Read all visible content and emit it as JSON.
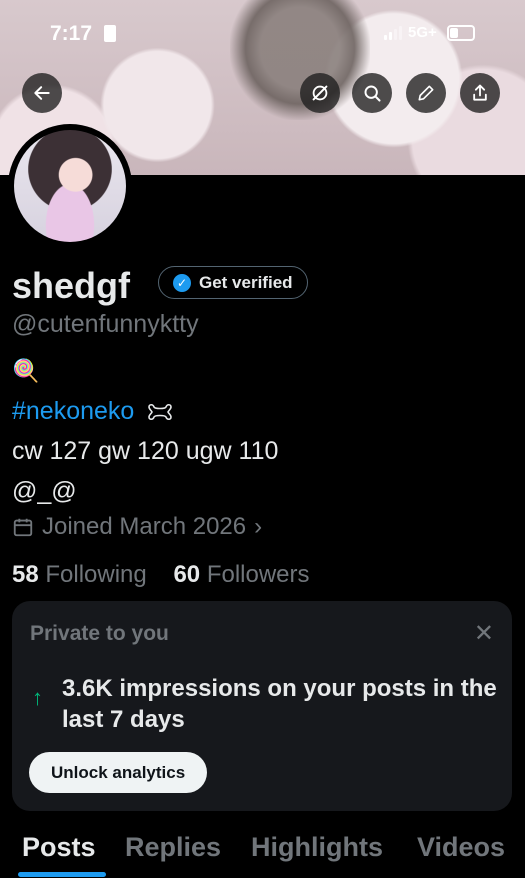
{
  "status_bar": {
    "time": "7:17",
    "network": "5G+"
  },
  "header": {
    "icons": [
      "back-arrow-icon",
      "grok-icon",
      "search-icon",
      "edit-icon",
      "share-icon"
    ]
  },
  "profile": {
    "display_name": "shedgf",
    "verify_label": "Get verified",
    "handle": "@cutenfunnyktty",
    "bio": {
      "emoji": "🍭",
      "hashtag": "#nekoneko",
      "line2": "cw 127 gw 120 ugw 110",
      "line3": "@_@"
    },
    "joined": "Joined March 2026",
    "following_count": "58",
    "following_label": "Following",
    "followers_count": "60",
    "followers_label": "Followers"
  },
  "analytics_card": {
    "title": "Private to you",
    "message": "3.6K impressions on your posts in the last 7 days",
    "button": "Unlock analytics"
  },
  "tabs": [
    {
      "label": "Posts",
      "active": true
    },
    {
      "label": "Replies",
      "active": false
    },
    {
      "label": "Highlights",
      "active": false
    },
    {
      "label": "Videos",
      "active": false
    }
  ],
  "colors": {
    "accent": "#1d9bf0",
    "positive": "#00ba7c",
    "muted": "#71767b",
    "card": "#16181c"
  }
}
